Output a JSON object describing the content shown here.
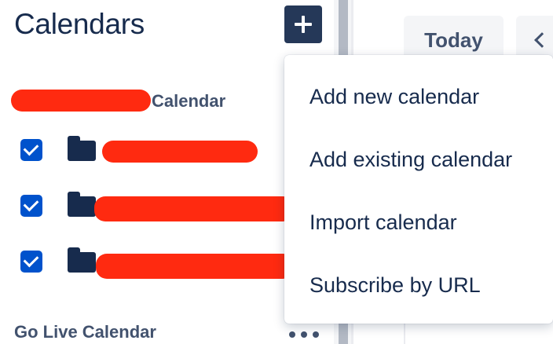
{
  "sidebar": {
    "title": "Calendars",
    "add_button_icon": "plus-icon",
    "group_label": "Calendar",
    "calendars": [
      {
        "checked": true
      },
      {
        "checked": true
      },
      {
        "checked": true
      }
    ],
    "live_group_label": "Go Live Calendar",
    "more_icon": "more-horizontal-icon"
  },
  "toolbar": {
    "today_label": "Today",
    "prev_icon": "chevron-left-icon"
  },
  "dropdown": {
    "items": [
      {
        "label": "Add new calendar"
      },
      {
        "label": "Add existing calendar"
      },
      {
        "label": "Import calendar"
      },
      {
        "label": "Subscribe by URL"
      }
    ]
  },
  "colors": {
    "title": "#172b4d",
    "add_button_bg": "#253858",
    "checkbox": "#0052cc",
    "folder": "#172b4d",
    "redaction": "#ff2a10"
  }
}
